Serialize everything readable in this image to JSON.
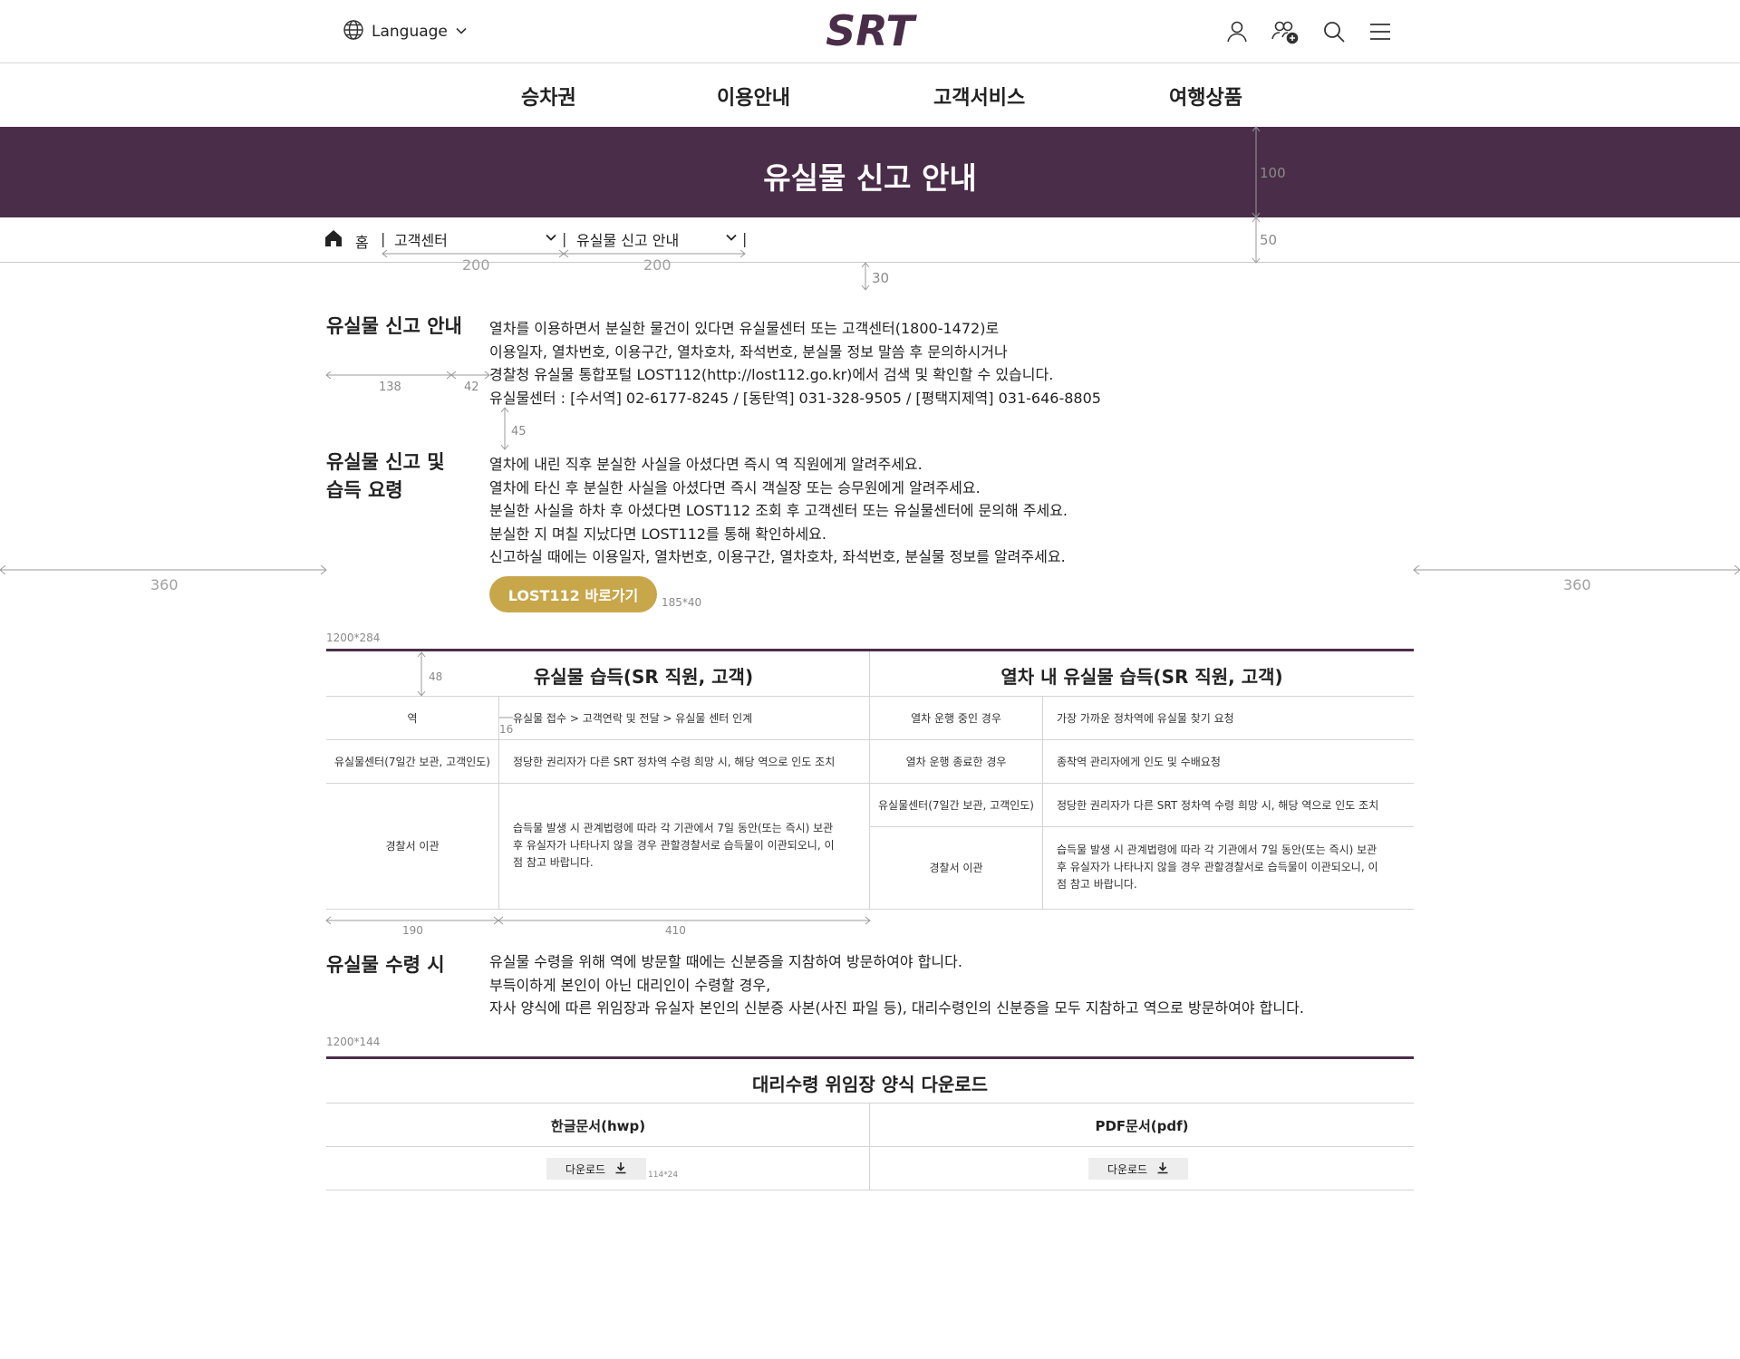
{
  "header": {
    "language_label": "Language",
    "logo_text": "SRT",
    "nav": [
      "승차권",
      "이용안내",
      "고객서비스",
      "여행상품"
    ]
  },
  "page_title": "유실물 신고 안내",
  "breadcrumb": {
    "home": "홈",
    "level1": "고객센터",
    "level2": "유실물 신고 안내",
    "separator": "|"
  },
  "section1": {
    "heading": "유실물 신고 안내",
    "lines": [
      "열차를 이용하면서 분실한 물건이 있다면 유실물센터 또는 고객센터(1800-1472)로",
      "이용일자, 열차번호, 이용구간, 열차호차, 좌석번호, 분실물 정보 말씀 후 문의하시거나",
      "경찰청 유실물 통합포털 LOST112(http://lost112.go.kr)에서 검색 및 확인할 수 있습니다.",
      "유실물센터 : [수서역] 02-6177-8245 / [동탄역] 031-328-9505 / [평택지제역] 031-646-8805"
    ]
  },
  "section2": {
    "heading_line1": "유실물 신고 및",
    "heading_line2": "습득 요령",
    "lines": [
      "열차에 내린 직후 분실한 사실을 아셨다면 즉시 역 직원에게 알려주세요.",
      "열차에 타신 후 분실한 사실을 아셨다면 즉시 객실장 또는 승무원에게 알려주세요.",
      "분실한 사실을 하차 후 아셨다면 LOST112 조회 후 고객센터 또는 유실물센터에 문의해 주세요.",
      "분실한 지 며칠 지났다면 LOST112를 통해 확인하세요.",
      "신고하실 때에는 이용일자, 열차번호, 이용구간, 열차호차, 좌석번호, 분실물 정보를 알려주세요."
    ],
    "button": "LOST112 바로가기"
  },
  "table1": {
    "left_title": "유실물 습득(SR 직원, 고객)",
    "right_title": "열차 내 유실물 습득(SR 직원, 고객)",
    "left_rows": [
      {
        "label": "역",
        "text": "유실물 접수 > 고객연락 및 전달 > 유실물 센터 인계"
      },
      {
        "label": "유실물센터(7일간 보관, 고객인도)",
        "text": "정당한 권리자가 다른 SRT 정차역 수령 희망 시, 해당 역으로 인도 조치"
      },
      {
        "label": "경찰서 이관",
        "text": "습득물 발생 시 관계법령에 따라 각 기관에서 7일 동안(또는 즉시) 보관 후 유실자가 나타나지 않을 경우 관할경찰서로 습득물이 이관되오니, 이점 참고 바랍니다."
      }
    ],
    "right_rows": [
      {
        "label": "열차 운행 중인 경우",
        "text": "가장 가까운 정차역에 유실물 찾기 요청"
      },
      {
        "label": "열차 운행 종료한 경우",
        "text": "종착역 관리자에게 인도 및 수배요청"
      },
      {
        "label": "유실물센터(7일간 보관, 고객인도)",
        "text": "정당한 권리자가 다른 SRT 정차역 수령 희망 시, 해당 역으로 인도 조치"
      },
      {
        "label": "경찰서 이관",
        "text": "습득물 발생 시 관계법령에 따라 각 기관에서 7일 동안(또는 즉시) 보관 후 유실자가 나타나지 않을 경우 관할경찰서로 습득물이 이관되오니, 이점 참고 바랍니다."
      }
    ]
  },
  "section3": {
    "heading": "유실물 수령 시",
    "lines": [
      "유실물 수령을 위해 역에 방문할 때에는 신분증을 지참하여 방문하여야 합니다.",
      "부득이하게 본인이 아닌 대리인이 수령할 경우,",
      "자사 양식에 따른 위임장과 유실자 본인의 신분증 사본(사진 파일 등), 대리수령인의 신분증을 모두 지참하고 역으로 방문하여야 합니다."
    ]
  },
  "download": {
    "title": "대리수령 위임장 양식 다운로드",
    "hwp_label": "한글문서(hwp)",
    "pdf_label": "PDF문서(pdf)",
    "button": "다운로드"
  },
  "spec": {
    "h100": "100",
    "h50": "50",
    "g30": "30",
    "w200a": "200",
    "w200b": "200",
    "w138": "138",
    "w42": "42",
    "g45": "45",
    "m360l": "360",
    "m360r": "360",
    "btn_size": "185*40",
    "box1": "1200*284",
    "g48": "48",
    "g16": "16",
    "w190": "190",
    "w410": "410",
    "box2": "1200*144",
    "dl_size": "114*24"
  },
  "colors": {
    "brand_purple": "#4a2d48",
    "button_gold": "#c8a64a"
  }
}
